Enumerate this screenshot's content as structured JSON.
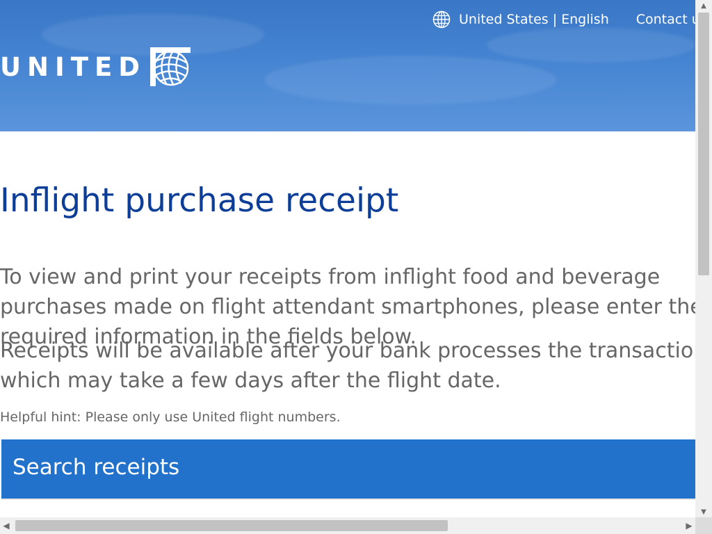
{
  "header": {
    "locale_label": "United States | English",
    "contact_label": "Contact us",
    "logo_text": "UNITED",
    "colors": {
      "sky_top": "#3a77c6",
      "sky_bottom": "#5b95dc",
      "text": "#ffffff"
    },
    "icons": {
      "locale": "globe-icon",
      "logo": "united-globe-logo-icon"
    }
  },
  "main": {
    "title": "Inflight purchase receipt",
    "intro": "To view and print your receipts from inflight food and beverage purchases made on flight attendant smartphones, please enter the required information in the fields below.",
    "availability_note": "Receipts will be available after your bank processes the transaction, which may take a few days after the flight date.",
    "hint": "Helpful hint: Please only use United flight numbers.",
    "search_panel": {
      "title": "Search receipts"
    },
    "colors": {
      "title": "#0d3e97",
      "body_text": "#666666",
      "panel": "#2272cc"
    }
  },
  "scrollbars": {
    "vertical_up_icon": "scroll-up-arrow-icon",
    "vertical_down_icon": "scroll-down-arrow-icon",
    "horizontal_left_icon": "scroll-left-arrow-icon",
    "horizontal_right_icon": "scroll-right-arrow-icon"
  }
}
